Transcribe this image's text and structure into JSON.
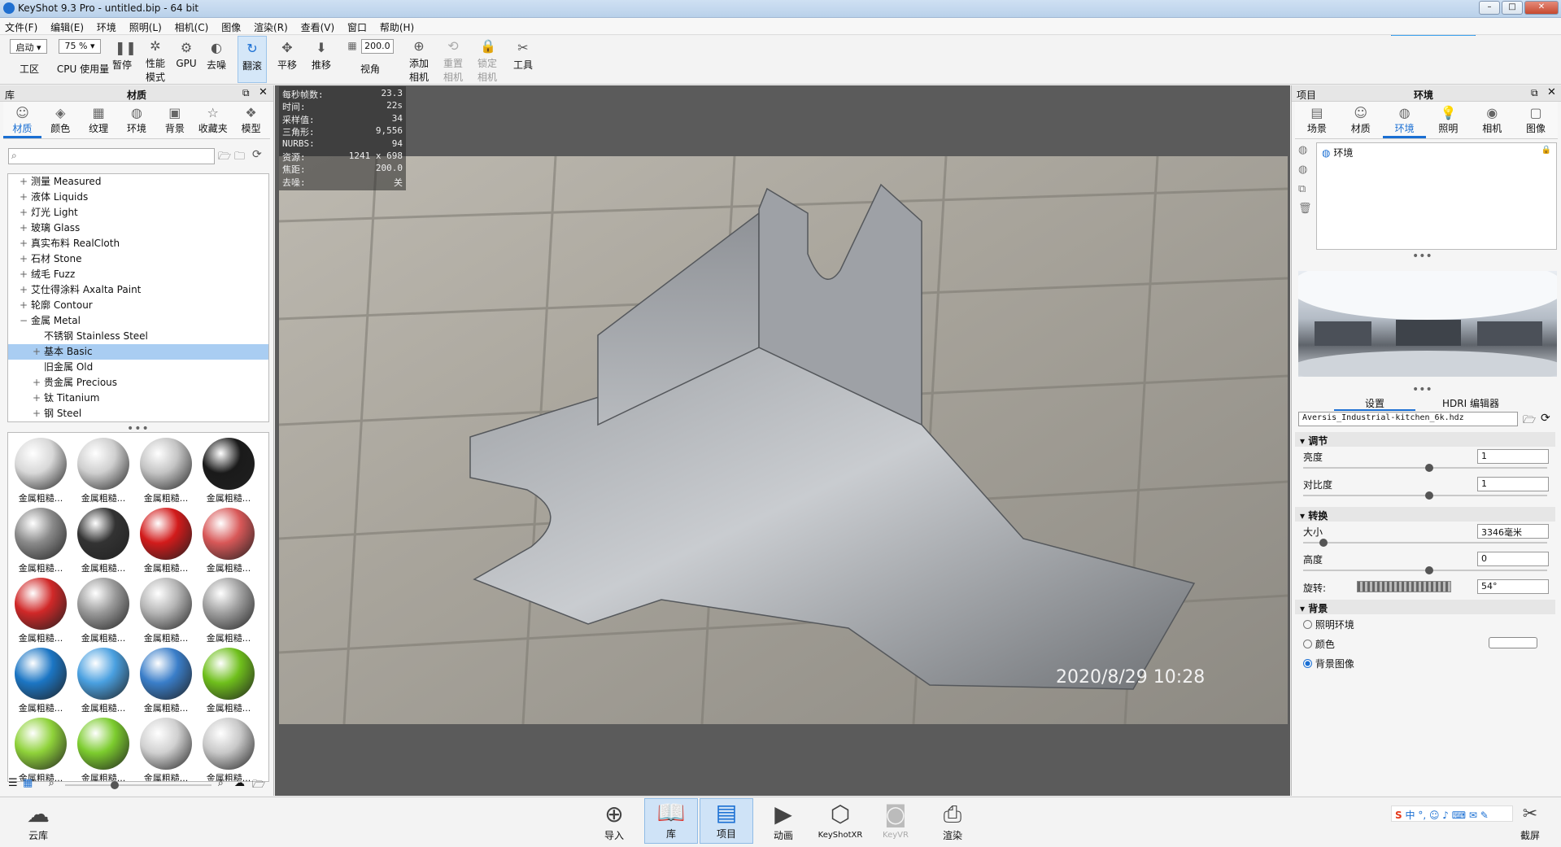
{
  "window": {
    "title": "KeyShot 9.3 Pro  - untitled.bip  - 64 bit",
    "min": "–",
    "max": "□",
    "close": "✕"
  },
  "menu": [
    "文件(F)",
    "编辑(E)",
    "环境",
    "照明(L)",
    "相机(C)",
    "图像",
    "渲染(R)",
    "查看(V)",
    "窗口",
    "帮助(H)"
  ],
  "toolbar": {
    "workspace_select": "启动",
    "workspace_label": "工区",
    "cpu_select": "75 %",
    "cpu_label": "CPU 使用量",
    "pause": "暂停",
    "perf_line1": "性能",
    "perf_line2": "模式",
    "gpu": "GPU",
    "denoise": "去噪",
    "tumble": "翻滚",
    "pan": "平移",
    "dolly": "推移",
    "fov_value": "200.0",
    "fov_label": "视角",
    "add_cam_1": "添加",
    "add_cam_2": "相机",
    "reset_cam_1": "重置",
    "reset_cam_2": "相机",
    "lock_cam_1": "锁定",
    "lock_cam_2": "相机",
    "tools": "工具"
  },
  "library": {
    "header": "库",
    "title": "材质",
    "tabs": [
      {
        "label": "材质",
        "icon": "material-icon"
      },
      {
        "label": "颜色",
        "icon": "color-icon"
      },
      {
        "label": "纹理",
        "icon": "texture-icon"
      },
      {
        "label": "环境",
        "icon": "environment-icon"
      },
      {
        "label": "背景",
        "icon": "background-icon"
      },
      {
        "label": "收藏夹",
        "icon": "favorites-icon"
      },
      {
        "label": "模型",
        "icon": "model-icon"
      }
    ],
    "search_placeholder": "",
    "tree": [
      {
        "label": "测量 Measured",
        "indent": 0,
        "sign": "+"
      },
      {
        "label": "液体 Liquids",
        "indent": 0,
        "sign": "+"
      },
      {
        "label": "灯光 Light",
        "indent": 0,
        "sign": "+"
      },
      {
        "label": "玻璃 Glass",
        "indent": 0,
        "sign": "+"
      },
      {
        "label": "真实布料 RealCloth",
        "indent": 0,
        "sign": "+"
      },
      {
        "label": "石材 Stone",
        "indent": 0,
        "sign": "+"
      },
      {
        "label": "绒毛 Fuzz",
        "indent": 0,
        "sign": "+"
      },
      {
        "label": "艾仕得涂料 Axalta Paint",
        "indent": 0,
        "sign": "+"
      },
      {
        "label": "轮廓 Contour",
        "indent": 0,
        "sign": "+"
      },
      {
        "label": "金属 Metal",
        "indent": 0,
        "sign": "−"
      },
      {
        "label": "不锈钢 Stainless Steel",
        "indent": 1,
        "sign": ""
      },
      {
        "label": "基本 Basic",
        "indent": 1,
        "sign": "+",
        "selected": true
      },
      {
        "label": "旧金属 Old",
        "indent": 1,
        "sign": ""
      },
      {
        "label": "贵金属 Precious",
        "indent": 1,
        "sign": "+"
      },
      {
        "label": "钛 Titanium",
        "indent": 1,
        "sign": "+"
      },
      {
        "label": "钢 Steel",
        "indent": 1,
        "sign": "+"
      }
    ],
    "thumb_label": "金属粗糙...",
    "thumbs": [
      "#d8d8d8",
      "#cfcfcf",
      "#c4c4c4",
      "#1a1a1a",
      "#8a8a8a",
      "#333333",
      "#d21b1b",
      "#d85858",
      "#d02828",
      "#9a9a9a",
      "#b5b5b5",
      "#a0a0a0",
      "#1c76c4",
      "#4aa0e0",
      "#3a7ec9",
      "#6fbf1c",
      "#8fd23a",
      "#7ccc2e",
      "#d0d0d0",
      "#c8c8c8"
    ]
  },
  "stats": [
    {
      "k": "每秒帧数:",
      "v": "23.3"
    },
    {
      "k": "时间:",
      "v": "22s"
    },
    {
      "k": "采样值:",
      "v": "34"
    },
    {
      "k": "三角形:",
      "v": "9,556"
    },
    {
      "k": "NURBS:",
      "v": "94"
    },
    {
      "k": "资源:",
      "v": "1241 x 698"
    },
    {
      "k": "焦距:",
      "v": "200.0"
    },
    {
      "k": "去噪:",
      "v": "关"
    }
  ],
  "render": {
    "timestamp": "2020/8/29  10:28"
  },
  "project": {
    "header": "项目",
    "title": "环境",
    "tabs": [
      {
        "label": "场景",
        "icon": "scene-icon"
      },
      {
        "label": "材质",
        "icon": "material-icon"
      },
      {
        "label": "环境",
        "icon": "environment-icon"
      },
      {
        "label": "照明",
        "icon": "lighting-icon"
      },
      {
        "label": "相机",
        "icon": "camera-icon"
      },
      {
        "label": "图像",
        "icon": "image-icon"
      }
    ],
    "env_item": "环境",
    "subtabs": [
      "设置",
      "HDRI 编辑器"
    ],
    "hdri_file": "Aversis_Industrial-kitchen_6k.hdz",
    "sections": {
      "adjust": "调节",
      "transform": "转换",
      "background": "背景"
    },
    "brightness_label": "亮度",
    "brightness": "1",
    "contrast_label": "对比度",
    "contrast": "1",
    "size_label": "大小",
    "size": "3346毫米",
    "height_label": "高度",
    "height": "0",
    "rotation_label": "旋转:",
    "rotation": "54°",
    "bg_options": [
      "照明环境",
      "颜色",
      "背景图像"
    ]
  },
  "bottombar": [
    {
      "label": "云库",
      "icon": "cloud-library-icon"
    },
    {
      "label": "导入",
      "icon": "import-icon"
    },
    {
      "label": "库",
      "icon": "library-icon"
    },
    {
      "label": "项目",
      "icon": "project-icon"
    },
    {
      "label": "动画",
      "icon": "animation-icon"
    },
    {
      "label": "KeyShotXR",
      "icon": "keyshotxr-icon"
    },
    {
      "label": "KeyVR",
      "icon": "keyvr-icon"
    },
    {
      "label": "渲染",
      "icon": "render-icon"
    },
    {
      "label": "截屏",
      "icon": "screenshot-icon"
    }
  ],
  "ime": {
    "lang": "中"
  }
}
